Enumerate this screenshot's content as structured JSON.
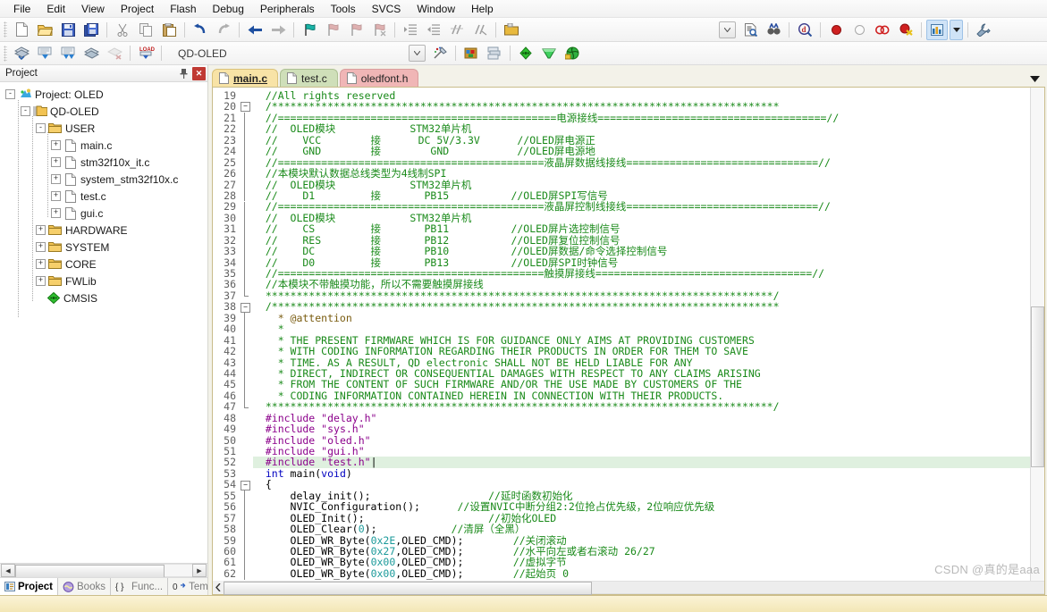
{
  "menu": {
    "items": [
      "File",
      "Edit",
      "View",
      "Project",
      "Flash",
      "Debug",
      "Peripherals",
      "Tools",
      "SVCS",
      "Window",
      "Help"
    ]
  },
  "toolbar1": {
    "icons": [
      {
        "name": "new-file-icon",
        "title": "New"
      },
      {
        "name": "open-file-icon",
        "title": "Open"
      },
      {
        "name": "save-icon",
        "title": "Save"
      },
      {
        "name": "save-all-icon",
        "title": "Save All"
      },
      {
        "name": "cut-icon",
        "title": "Cut"
      },
      {
        "name": "copy-icon",
        "title": "Copy"
      },
      {
        "name": "paste-icon",
        "title": "Paste"
      },
      {
        "name": "undo-icon",
        "title": "Undo"
      },
      {
        "name": "redo-icon",
        "title": "Redo"
      },
      {
        "name": "navigate-back-icon",
        "title": "Back"
      },
      {
        "name": "navigate-forward-icon",
        "title": "Forward"
      },
      {
        "name": "bookmark-toggle-icon",
        "title": "Insert/Remove Bookmark"
      },
      {
        "name": "bookmark-prev-icon",
        "title": "Previous Bookmark"
      },
      {
        "name": "bookmark-next-icon",
        "title": "Next Bookmark"
      },
      {
        "name": "bookmark-clear-icon",
        "title": "Clear All Bookmarks"
      },
      {
        "name": "indent-right-icon",
        "title": "Indent"
      },
      {
        "name": "indent-left-icon",
        "title": "Outdent"
      },
      {
        "name": "comment-icon",
        "title": "Comment"
      },
      {
        "name": "uncomment-icon",
        "title": "Uncomment"
      },
      {
        "name": "open-folder-icon",
        "title": "Open Containing Folder"
      },
      {
        "name": "combo-dropdown-icon",
        "title": "Search Combo"
      },
      {
        "name": "find-in-files-icon",
        "title": "Find in Files"
      },
      {
        "name": "binoculars-icon",
        "title": "Find"
      },
      {
        "name": "quick-find-icon",
        "title": "Quick Find"
      },
      {
        "name": "breakpoint-icon",
        "title": "Insert/Remove Breakpoint"
      },
      {
        "name": "breakpoint-disable-icon",
        "title": "Enable/Disable Breakpoint"
      },
      {
        "name": "breakpoint-disable-all-icon",
        "title": "Disable All Breakpoints"
      },
      {
        "name": "breakpoint-kill-all-icon",
        "title": "Kill All Breakpoints"
      },
      {
        "name": "debug-window-icon",
        "title": "Debug Windows"
      },
      {
        "name": "chevron-down-icon",
        "title": "More"
      },
      {
        "name": "configure-icon",
        "title": "Configuration Wizard"
      }
    ]
  },
  "toolbar2": {
    "icons": [
      {
        "name": "translate-icon",
        "title": "Translate"
      },
      {
        "name": "build-icon",
        "title": "Build"
      },
      {
        "name": "rebuild-icon",
        "title": "Rebuild"
      },
      {
        "name": "batch-build-icon",
        "title": "Batch Build"
      },
      {
        "name": "stop-build-icon",
        "title": "Stop Build"
      },
      {
        "name": "download-icon",
        "title": "Download"
      },
      {
        "name": "target-dropdown-icon",
        "title": "Select Target"
      },
      {
        "name": "target-options-icon",
        "title": "Target Options"
      },
      {
        "name": "manage-project-icon",
        "title": "Manage Project Items"
      },
      {
        "name": "multi-project-icon",
        "title": "Multi-Project"
      },
      {
        "name": "components-icon",
        "title": "Components"
      },
      {
        "name": "pack-installer-icon",
        "title": "Pack Installer"
      },
      {
        "name": "manage-rte-icon",
        "title": "Manage Run-Time Environment"
      }
    ],
    "target": "QD-OLED"
  },
  "project_pane": {
    "title": "Project",
    "pin_icon": "pin-icon",
    "close_icon": "close-icon",
    "tree": [
      {
        "label": "Project: OLED",
        "depth": 0,
        "expander": "-",
        "icon": "project-icon"
      },
      {
        "label": "QD-OLED",
        "depth": 1,
        "expander": "-",
        "icon": "target-folder-icon"
      },
      {
        "label": "USER",
        "depth": 2,
        "expander": "-",
        "icon": "group-folder-icon"
      },
      {
        "label": "main.c",
        "depth": 3,
        "expander": "+",
        "icon": "c-file-icon"
      },
      {
        "label": "stm32f10x_it.c",
        "depth": 3,
        "expander": "+",
        "icon": "c-file-icon"
      },
      {
        "label": "system_stm32f10x.c",
        "depth": 3,
        "expander": "+",
        "icon": "c-file-icon"
      },
      {
        "label": "test.c",
        "depth": 3,
        "expander": "+",
        "icon": "c-file-icon"
      },
      {
        "label": "gui.c",
        "depth": 3,
        "expander": "+",
        "icon": "c-file-icon"
      },
      {
        "label": "HARDWARE",
        "depth": 2,
        "expander": "+",
        "icon": "group-folder-icon"
      },
      {
        "label": "SYSTEM",
        "depth": 2,
        "expander": "+",
        "icon": "group-folder-icon"
      },
      {
        "label": "CORE",
        "depth": 2,
        "expander": "+",
        "icon": "group-folder-icon"
      },
      {
        "label": "FWLib",
        "depth": 2,
        "expander": "+",
        "icon": "group-folder-icon"
      },
      {
        "label": "CMSIS",
        "depth": 2,
        "expander": "",
        "icon": "cmsis-icon"
      }
    ],
    "bottom_tabs": [
      {
        "label": "Project",
        "icon": "project-tab-icon",
        "selected": true
      },
      {
        "label": "Books",
        "icon": "books-tab-icon",
        "selected": false
      },
      {
        "label": "Func...",
        "icon": "functions-tab-icon",
        "selected": false
      },
      {
        "label": "Temp...",
        "icon": "templates-tab-icon",
        "selected": false
      }
    ]
  },
  "editor": {
    "tabs": [
      {
        "label": "main.c",
        "style": "t-main",
        "active": true
      },
      {
        "label": "test.c",
        "style": "t-test",
        "active": false
      },
      {
        "label": "oledfont.h",
        "style": "t-font",
        "active": false
      }
    ],
    "tabstrip_menu_icon": "chevron-down-icon",
    "first_line_number": 19,
    "lines": [
      {
        "n": 19,
        "fold": "",
        "segs": [
          {
            "t": "  //All rights reserved",
            "c": "cmt"
          }
        ]
      },
      {
        "n": 20,
        "fold": "-",
        "segs": [
          {
            "t": "  /**********************************************************************************",
            "c": "cmt"
          }
        ]
      },
      {
        "n": 21,
        "fold": "|",
        "segs": [
          {
            "t": "  //=============================================电源接线=====================================//",
            "c": "cmt"
          }
        ]
      },
      {
        "n": 22,
        "fold": "|",
        "segs": [
          {
            "t": "  //  OLED模块            STM32单片机",
            "c": "cmt"
          }
        ]
      },
      {
        "n": 23,
        "fold": "|",
        "segs": [
          {
            "t": "  //    VCC        接      DC 5V/3.3V      //OLED屏电源正",
            "c": "cmt"
          }
        ]
      },
      {
        "n": 24,
        "fold": "|",
        "segs": [
          {
            "t": "  //    GND        接        GND           //OLED屏电源地",
            "c": "cmt"
          }
        ]
      },
      {
        "n": 25,
        "fold": "|",
        "segs": [
          {
            "t": "  //===========================================液晶屏数据线接线===============================//",
            "c": "cmt"
          }
        ]
      },
      {
        "n": 26,
        "fold": "|",
        "segs": [
          {
            "t": "  //本模块默认数据总线类型为4线制SPI",
            "c": "cmt"
          }
        ]
      },
      {
        "n": 27,
        "fold": "|",
        "segs": [
          {
            "t": "  //  OLED模块            STM32单片机",
            "c": "cmt"
          }
        ]
      },
      {
        "n": 28,
        "fold": "|",
        "segs": [
          {
            "t": "  //    D1         接       PB15          //OLED屏SPI写信号",
            "c": "cmt"
          }
        ]
      },
      {
        "n": 29,
        "fold": "|",
        "segs": [
          {
            "t": "  //===========================================液晶屏控制线接线===============================//",
            "c": "cmt"
          }
        ]
      },
      {
        "n": 30,
        "fold": "|",
        "segs": [
          {
            "t": "  //  OLED模块            STM32单片机",
            "c": "cmt"
          }
        ]
      },
      {
        "n": 31,
        "fold": "|",
        "segs": [
          {
            "t": "  //    CS         接       PB11          //OLED屏片选控制信号",
            "c": "cmt"
          }
        ]
      },
      {
        "n": 32,
        "fold": "|",
        "segs": [
          {
            "t": "  //    RES        接       PB12          //OLED屏复位控制信号",
            "c": "cmt"
          }
        ]
      },
      {
        "n": 33,
        "fold": "|",
        "segs": [
          {
            "t": "  //    DC         接       PB10          //OLED屏数据/命令选择控制信号",
            "c": "cmt"
          }
        ]
      },
      {
        "n": 34,
        "fold": "|",
        "segs": [
          {
            "t": "  //    D0         接       PB13          //OLED屏SPI时钟信号",
            "c": "cmt"
          }
        ]
      },
      {
        "n": 35,
        "fold": "|",
        "segs": [
          {
            "t": "  //===========================================触摸屏接线===================================//",
            "c": "cmt"
          }
        ]
      },
      {
        "n": 36,
        "fold": "|",
        "segs": [
          {
            "t": "  //本模块不带触摸功能，所以不需要触摸屏接线",
            "c": "cmt"
          }
        ]
      },
      {
        "n": 37,
        "fold": "L",
        "segs": [
          {
            "t": "  **********************************************************************************/",
            "c": "cmt"
          }
        ]
      },
      {
        "n": 38,
        "fold": "-",
        "segs": [
          {
            "t": "  /**********************************************************************************",
            "c": "cmt"
          }
        ]
      },
      {
        "n": 39,
        "fold": "|",
        "segs": [
          {
            "t": "    * @attention",
            "c": "attn"
          }
        ]
      },
      {
        "n": 40,
        "fold": "|",
        "segs": [
          {
            "t": "    *",
            "c": "cmt"
          }
        ]
      },
      {
        "n": 41,
        "fold": "|",
        "segs": [
          {
            "t": "    * THE PRESENT FIRMWARE WHICH IS FOR GUIDANCE ONLY AIMS AT PROVIDING CUSTOMERS",
            "c": "cmt"
          }
        ]
      },
      {
        "n": 42,
        "fold": "|",
        "segs": [
          {
            "t": "    * WITH CODING INFORMATION REGARDING THEIR PRODUCTS IN ORDER FOR THEM TO SAVE",
            "c": "cmt"
          }
        ]
      },
      {
        "n": 43,
        "fold": "|",
        "segs": [
          {
            "t": "    * TIME. AS A RESULT, QD electronic SHALL NOT BE HELD LIABLE FOR ANY",
            "c": "cmt"
          }
        ]
      },
      {
        "n": 44,
        "fold": "|",
        "segs": [
          {
            "t": "    * DIRECT, INDIRECT OR CONSEQUENTIAL DAMAGES WITH RESPECT TO ANY CLAIMS ARISING",
            "c": "cmt"
          }
        ]
      },
      {
        "n": 45,
        "fold": "|",
        "segs": [
          {
            "t": "    * FROM THE CONTENT OF SUCH FIRMWARE AND/OR THE USE MADE BY CUSTOMERS OF THE",
            "c": "cmt"
          }
        ]
      },
      {
        "n": 46,
        "fold": "|",
        "segs": [
          {
            "t": "    * CODING INFORMATION CONTAINED HEREIN IN CONNECTION WITH THEIR PRODUCTS.",
            "c": "cmt"
          }
        ]
      },
      {
        "n": 47,
        "fold": "L",
        "segs": [
          {
            "t": "  **********************************************************************************/",
            "c": "cmt"
          }
        ]
      },
      {
        "n": 48,
        "fold": "",
        "segs": [
          {
            "t": "  #include ",
            "c": "pp"
          },
          {
            "t": "\"delay.h\"",
            "c": "str"
          }
        ]
      },
      {
        "n": 49,
        "fold": "",
        "segs": [
          {
            "t": "  #include ",
            "c": "pp"
          },
          {
            "t": "\"sys.h\"",
            "c": "str"
          }
        ]
      },
      {
        "n": 50,
        "fold": "",
        "segs": [
          {
            "t": "  #include ",
            "c": "pp"
          },
          {
            "t": "\"oled.h\"",
            "c": "str"
          }
        ]
      },
      {
        "n": 51,
        "fold": "",
        "segs": [
          {
            "t": "  #include ",
            "c": "pp"
          },
          {
            "t": "\"gui.h\"",
            "c": "str"
          }
        ]
      },
      {
        "n": 52,
        "fold": "",
        "hl": true,
        "segs": [
          {
            "t": "  #include ",
            "c": "pp"
          },
          {
            "t": "\"test.h\"",
            "c": "str"
          },
          {
            "t": "|",
            "c": "plain"
          }
        ]
      },
      {
        "n": 53,
        "fold": "",
        "segs": [
          {
            "t": "  int ",
            "c": "kw"
          },
          {
            "t": "main(",
            "c": "plain"
          },
          {
            "t": "void",
            "c": "kw"
          },
          {
            "t": ")",
            "c": "plain"
          }
        ]
      },
      {
        "n": 54,
        "fold": "-",
        "segs": [
          {
            "t": "  {",
            "c": "plain"
          }
        ]
      },
      {
        "n": 55,
        "fold": "|",
        "segs": [
          {
            "t": "      delay_init();                   ",
            "c": "plain"
          },
          {
            "t": "//延时函数初始化",
            "c": "cmt"
          }
        ]
      },
      {
        "n": 56,
        "fold": "|",
        "segs": [
          {
            "t": "      NVIC_Configuration();      ",
            "c": "plain"
          },
          {
            "t": "//设置NVIC中断分组2:2位抢占优先级，2位响应优先级",
            "c": "cmt"
          }
        ]
      },
      {
        "n": 57,
        "fold": "|",
        "segs": [
          {
            "t": "      OLED_Init();                    ",
            "c": "plain"
          },
          {
            "t": "//初始化OLED",
            "c": "cmt"
          }
        ]
      },
      {
        "n": 58,
        "fold": "|",
        "segs": [
          {
            "t": "      OLED_Clear(",
            "c": "plain"
          },
          {
            "t": "0",
            "c": "num"
          },
          {
            "t": ");            ",
            "c": "plain"
          },
          {
            "t": "//清屏（全黑）",
            "c": "cmt"
          }
        ]
      },
      {
        "n": 59,
        "fold": "|",
        "segs": [
          {
            "t": "      OLED_WR_Byte(",
            "c": "plain"
          },
          {
            "t": "0x2E",
            "c": "num"
          },
          {
            "t": ",OLED_CMD);        ",
            "c": "plain"
          },
          {
            "t": "//关闭滚动",
            "c": "cmt"
          }
        ]
      },
      {
        "n": 60,
        "fold": "|",
        "segs": [
          {
            "t": "      OLED_WR_Byte(",
            "c": "plain"
          },
          {
            "t": "0x27",
            "c": "num"
          },
          {
            "t": ",OLED_CMD);        ",
            "c": "plain"
          },
          {
            "t": "//水平向左或者右滚动 26/27",
            "c": "cmt"
          }
        ]
      },
      {
        "n": 61,
        "fold": "|",
        "segs": [
          {
            "t": "      OLED_WR_Byte(",
            "c": "plain"
          },
          {
            "t": "0x00",
            "c": "num"
          },
          {
            "t": ",OLED_CMD);        ",
            "c": "plain"
          },
          {
            "t": "//虚拟字节",
            "c": "cmt"
          }
        ]
      },
      {
        "n": 62,
        "fold": "|",
        "segs": [
          {
            "t": "      OLED_WR_Byte(",
            "c": "plain"
          },
          {
            "t": "0x00",
            "c": "num"
          },
          {
            "t": ",OLED_CMD);        ",
            "c": "plain"
          },
          {
            "t": "//起始页 0",
            "c": "cmt"
          }
        ]
      }
    ]
  },
  "watermark": "CSDN @真的是aaa",
  "colors": {
    "comment_green": "#1a8a1a",
    "preprocessor_purple": "#8b008b",
    "keyword_blue": "#0000c0",
    "number_teal": "#1b9a9a",
    "tab_active_yellow": "#f8e3a6",
    "tab_test_green": "#cfdfb9",
    "tab_font_pink": "#f0b6b6",
    "highlight_line": "#dff0df",
    "status_bar": "#f3e7b5"
  }
}
